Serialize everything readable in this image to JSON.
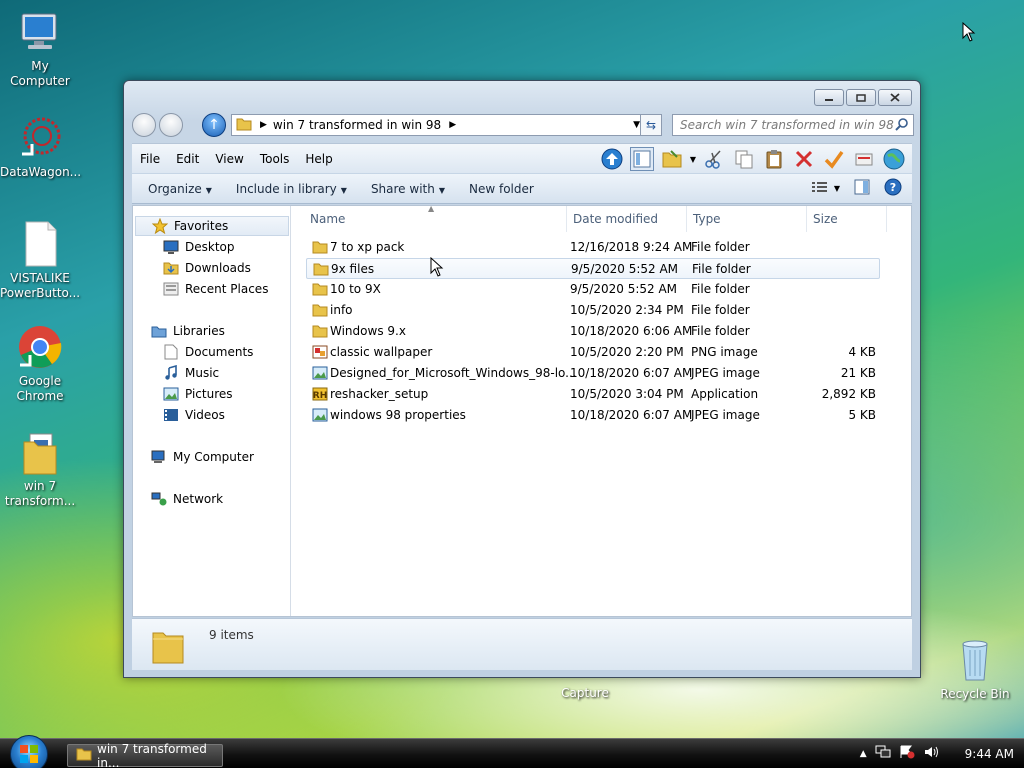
{
  "desktop": {
    "icons": [
      {
        "label": "My Computer"
      },
      {
        "label": "DataWagon..."
      },
      {
        "label": "VISTALIKE PowerButto..."
      },
      {
        "label": "Google Chrome"
      },
      {
        "label": "win 7 transform..."
      },
      {
        "label": "Capture"
      },
      {
        "label": "Recycle Bin"
      }
    ]
  },
  "window": {
    "address": {
      "folder": "win 7 transformed in win 98"
    },
    "search": {
      "placeholder": "Search win 7 transformed in win 98"
    },
    "menu": [
      "File",
      "Edit",
      "View",
      "Tools",
      "Help"
    ],
    "commands": [
      "Organize",
      "Include in library",
      "Share with",
      "New folder"
    ],
    "nav": {
      "favorites": "Favorites",
      "fav_items": [
        "Desktop",
        "Downloads",
        "Recent Places"
      ],
      "libraries": "Libraries",
      "lib_items": [
        "Documents",
        "Music",
        "Pictures",
        "Videos"
      ],
      "computer": "My Computer",
      "network": "Network"
    },
    "columns": [
      "Name",
      "Date modified",
      "Type",
      "Size"
    ],
    "files": [
      {
        "name": "7 to xp pack",
        "date": "12/16/2018 9:24 AM",
        "type": "File folder",
        "size": "",
        "icon": "folder-icon"
      },
      {
        "name": "9x files",
        "date": "9/5/2020 5:52 AM",
        "type": "File folder",
        "size": "",
        "icon": "folder-icon"
      },
      {
        "name": "10 to 9X",
        "date": "9/5/2020 5:52 AM",
        "type": "File folder",
        "size": "",
        "icon": "folder-icon"
      },
      {
        "name": "info",
        "date": "10/5/2020 2:34 PM",
        "type": "File folder",
        "size": "",
        "icon": "folder-icon"
      },
      {
        "name": "Windows 9.x",
        "date": "10/18/2020 6:06 AM",
        "type": "File folder",
        "size": "",
        "icon": "folder-icon"
      },
      {
        "name": "classic wallpaper",
        "date": "10/5/2020 2:20 PM",
        "type": "PNG image",
        "size": "4 KB",
        "icon": "png-image-icon"
      },
      {
        "name": "Designed_for_Microsoft_Windows_98-lo...",
        "date": "10/18/2020 6:07 AM",
        "type": "JPEG image",
        "size": "21 KB",
        "icon": "jpeg-image-icon"
      },
      {
        "name": "reshacker_setup",
        "date": "10/5/2020 3:04 PM",
        "type": "Application",
        "size": "2,892 KB",
        "icon": "application-icon"
      },
      {
        "name": "windows 98 properties",
        "date": "10/18/2020 6:07 AM",
        "type": "JPEG image",
        "size": "5 KB",
        "icon": "jpeg-image-icon"
      }
    ],
    "details": {
      "count": "9 items"
    }
  },
  "taskbar": {
    "task_label": "win 7 transformed in...",
    "clock": "9:44 AM"
  },
  "colors": {
    "folder": "#e8c34a",
    "accent": "#1a5fb4",
    "close_red": "#d43030"
  }
}
